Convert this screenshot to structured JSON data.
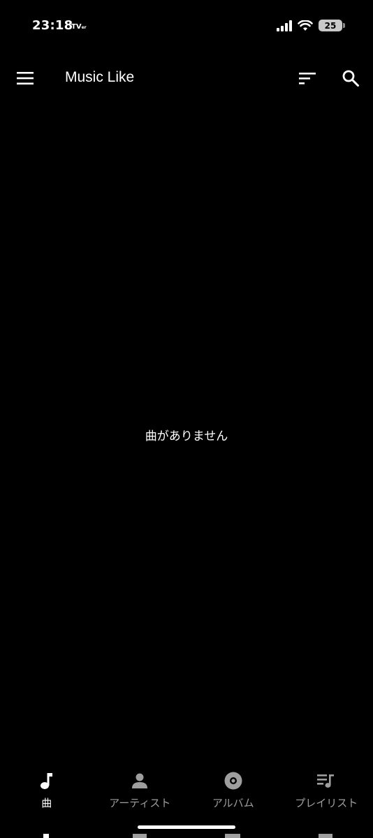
{
  "status_bar": {
    "time": "23:18",
    "app_badge": "TV",
    "app_badge_sub": "er",
    "battery": "25"
  },
  "app_bar": {
    "title": "Music Like",
    "menu_icon": "hamburger-menu-icon",
    "sort_icon": "sort-icon",
    "search_icon": "search-icon"
  },
  "main": {
    "empty_message": "曲がありません"
  },
  "bottom_nav": {
    "items": [
      {
        "label": "曲",
        "icon": "music-note-icon",
        "active": true
      },
      {
        "label": "アーティスト",
        "icon": "person-icon",
        "active": false
      },
      {
        "label": "アルバム",
        "icon": "album-disc-icon",
        "active": false
      },
      {
        "label": "プレイリスト",
        "icon": "playlist-icon",
        "active": false
      }
    ]
  },
  "colors": {
    "background": "#000000",
    "active": "#ffffff",
    "inactive": "#9e9e9e"
  }
}
